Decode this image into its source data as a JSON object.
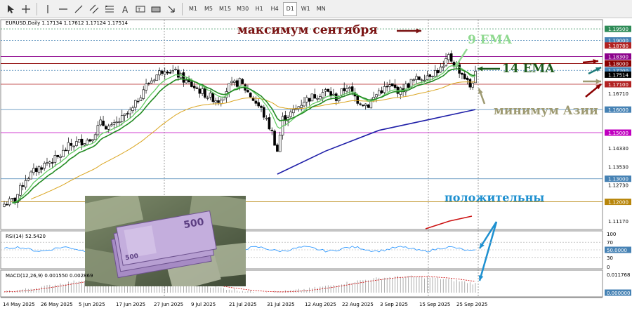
{
  "toolbar": {
    "periods": [
      "M1",
      "M5",
      "M15",
      "M30",
      "H1",
      "H4",
      "D1",
      "W1",
      "MN"
    ],
    "active_period": "D1",
    "tools": [
      "cursor-icon",
      "crosshair-icon",
      "vertical-line-icon",
      "horizontal-line-icon",
      "trendline-icon",
      "channel-icon",
      "fibonacci-icon",
      "text-icon",
      "text-label-icon",
      "rectangle-icon",
      "arrows-icon"
    ]
  },
  "symbol": {
    "header": "EURUSD,Daily  1.17134  1.17612  1.17124  1.17514"
  },
  "price_axis": {
    "ticks": [
      "1.19500",
      "1.19000",
      "1.18780",
      "1.18300",
      "1.18000",
      "1.17700",
      "1.17514",
      "1.17100",
      "1.16710",
      "1.16000",
      "1.15000",
      "1.14330",
      "1.13530",
      "1.13000",
      "1.12730",
      "1.12000",
      "1.11170"
    ],
    "tags": [
      {
        "value": "1.19500",
        "color": "#2e8b57"
      },
      {
        "value": "1.19000",
        "color": "#4682b4"
      },
      {
        "value": "1.18780",
        "color": "#b22222"
      },
      {
        "value": "1.18300",
        "color": "#8b008b"
      },
      {
        "value": "1.18000",
        "color": "#8b0000"
      },
      {
        "value": "1.17700",
        "color": "#4682b4"
      },
      {
        "value": "1.17514",
        "color": "#000000"
      },
      {
        "value": "1.17100",
        "color": "#b22222"
      },
      {
        "value": "1.16000",
        "color": "#4682b4"
      },
      {
        "value": "1.15000",
        "color": "#c000c0"
      },
      {
        "value": "1.13000",
        "color": "#4682b4"
      },
      {
        "value": "1.12000",
        "color": "#b8860b"
      }
    ]
  },
  "dates": [
    "14 May 2025",
    "26 May 2025",
    "5 Jun 2025",
    "17 Jun 2025",
    "27 Jun 2025",
    "9 Jul 2025",
    "21 Jul 2025",
    "31 Jul 2025",
    "12 Aug 2025",
    "22 Aug 2025",
    "3 Sep 2025",
    "15 Sep 2025",
    "25 Sep 2025"
  ],
  "annotations": {
    "sept_max": "максимум сентября",
    "ema9": "9 EMA",
    "ema14": "14 EMA",
    "asia_min": "минимум Азии",
    "positive": "положительны"
  },
  "indicators": {
    "rsi": {
      "label": "RSI(14) 52.5420",
      "levels": [
        "100",
        "70",
        "50.0000",
        "30",
        "0"
      ]
    },
    "macd": {
      "label": "MACD(12,26,9) 0.001550 0.002869",
      "levels": [
        "0.011768",
        "0.000000"
      ]
    }
  },
  "colors": {
    "ema9": "#66cc66",
    "ema14": "#228b22",
    "ema_slow": "#daa520",
    "ema_long": "#1f1fa8",
    "bear": "#000000",
    "bull": "#ffffff",
    "annot_red": "#7a1313",
    "annot_green": "#8fd98f",
    "annot_dark_green": "#1c5a1c",
    "annot_olive": "#9e9a72",
    "annot_blue": "#1e90d0"
  }
}
